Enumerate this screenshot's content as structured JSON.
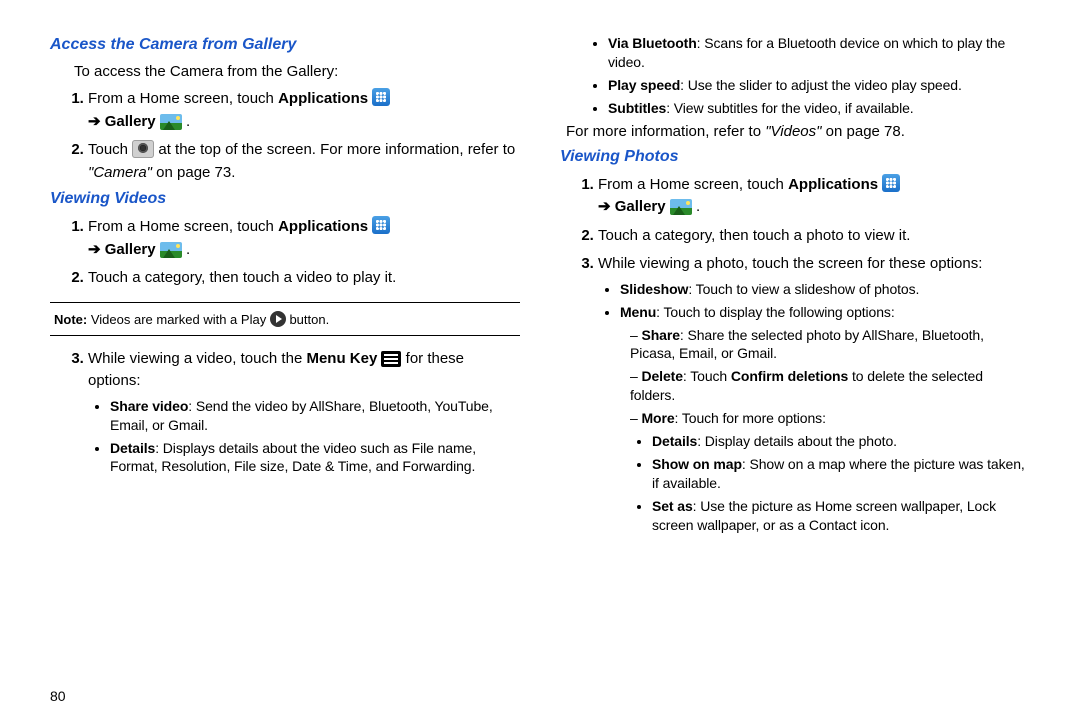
{
  "left": {
    "h_access": "Access the Camera from Gallery",
    "access_intro": "To access the Camera from the Gallery:",
    "step1_a": "From a Home screen, touch ",
    "step1_b": "Applications",
    "step1_c": " ",
    "step1_arrow": "➔ ",
    "step1_gallery": "Gallery",
    "step1_end": " .",
    "step2_a": "Touch ",
    "step2_b": " at the top of the screen. For more information, refer to ",
    "step2_em": "\"Camera\"",
    "step2_end": " on page 73.",
    "h_videos": "Viewing Videos",
    "v_step1_a": "From a Home screen, touch ",
    "v_step1_b": "Applications",
    "v_step1_arrow": "➔ ",
    "v_step1_gallery": "Gallery",
    "v_step1_end": " .",
    "v_step2": "Touch a category, then touch a video to play it.",
    "note_label": "Note: ",
    "note_a": "Videos are marked with a Play ",
    "note_b": " button.",
    "v_step3_a": "While viewing a video, touch the ",
    "v_step3_b": "Menu Key",
    "v_step3_c": "  for these options:",
    "share_b": "Share video",
    "share_t": ": Send the video by AllShare, Bluetooth, YouTube, Email, or Gmail.",
    "details_b": "Details",
    "details_t": ": Displays details about the video such as File name, Format, Resolution, File size, Date & Time, and Forwarding."
  },
  "right": {
    "bt_b": "Via Bluetooth",
    "bt_t": ": Scans for a Bluetooth device on which to play the video.",
    "ps_b": "Play speed",
    "ps_t": ": Use the slider to adjust the video play speed.",
    "sub_b": "Subtitles",
    "sub_t": ": View subtitles for the video, if available.",
    "more_info_a": "For more information, refer to ",
    "more_info_em": "\"Videos\"",
    "more_info_b": " on page 78.",
    "h_photos": "Viewing Photos",
    "p_step1_a": "From a Home screen, touch ",
    "p_step1_b": "Applications",
    "p_step1_arrow": "➔ ",
    "p_step1_gallery": "Gallery",
    "p_step1_end": " .",
    "p_step2": "Touch a category, then touch a photo to view it.",
    "p_step3": "While viewing a photo, touch the screen for these options:",
    "ss_b": "Slideshow",
    "ss_t": ": Touch to view a slideshow of photos.",
    "menu_b": "Menu",
    "menu_t": ": Touch to display the following options:",
    "share_b": "Share",
    "share_t": ": Share the selected photo by AllShare, Bluetooth, Picasa, Email, or Gmail.",
    "del_b": "Delete",
    "del_a": ": Touch ",
    "del_cb": "Confirm deletions",
    "del_t": " to delete the selected folders.",
    "more_b": "More",
    "more_t": ": Touch for more options:",
    "d_b": "Details",
    "d_t": ": Display details about the photo.",
    "som_b": "Show on map",
    "som_t": ": Show on a map where the picture was taken, if available.",
    "sa_b": "Set as",
    "sa_t": ": Use the picture as Home screen wallpaper, Lock screen wallpaper, or as a Contact icon."
  },
  "page_number": "80"
}
